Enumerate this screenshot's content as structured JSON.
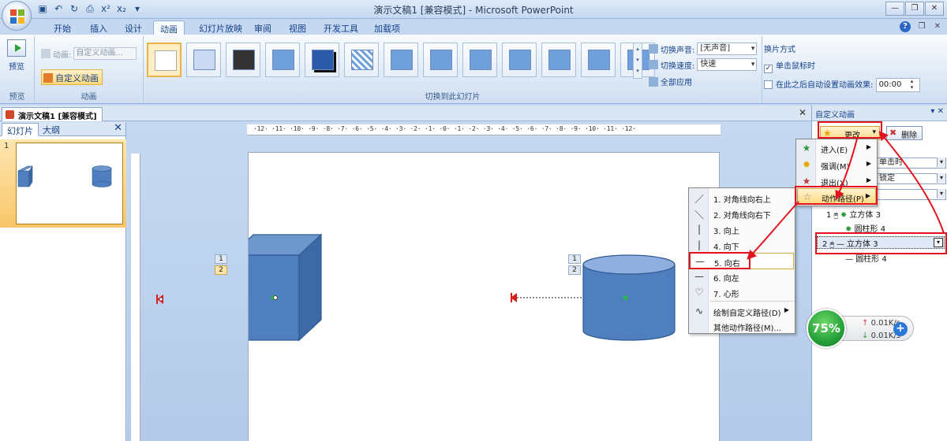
{
  "app": {
    "title": "演示文稿1 [兼容模式] - Microsoft PowerPoint",
    "doc_tab": "演示文稿1 [兼容模式]"
  },
  "ribbon_tabs": [
    "开始",
    "插入",
    "设计",
    "动画",
    "幻灯片放映",
    "审阅",
    "视图",
    "开发工具",
    "加载项"
  ],
  "active_tab": "动画",
  "ribbon": {
    "preview_label": "预览",
    "preview_group": "预览",
    "animate_label": "动画:",
    "animate_value": "自定义动画...",
    "custom_animation_btn": "自定义动画",
    "animation_group": "动画",
    "transition_group": "切换到此幻灯片",
    "sound_label": "切换声音:",
    "sound_value": "[无声音]",
    "speed_label": "切换速度:",
    "speed_value": "快速",
    "apply_all": "全部应用",
    "advance_title": "换片方式",
    "on_click": "单击鼠标时",
    "auto_after": "在此之后自动设置动画效果:",
    "auto_time": "00:00"
  },
  "left_pane": {
    "tab_slides": "幻灯片",
    "tab_outline": "大纲",
    "slide_number": "1"
  },
  "ruler_text": "·12· ·11· ·10· ·9· ·8· ·7· ·6· ·5· ·4· ·3· ·2· ·1· ·0· ·1· ·2· ·3· ·4· ·5· ·6· ·7· ·8· ·9· ·10· ·11· ·12·",
  "slide": {
    "cube_tags": [
      "1",
      "2"
    ],
    "cyl_tags": [
      "1",
      "2"
    ]
  },
  "task_pane": {
    "title": "自定义动画",
    "change_btn": "更改",
    "delete_btn": "删除",
    "start_value": "单击时",
    "dir_value": "锁定",
    "items": [
      {
        "num": "1",
        "name": "立方体 3"
      },
      {
        "num": "",
        "name": "圆柱形 4"
      },
      {
        "num": "2",
        "name": "立方体 3"
      },
      {
        "num": "",
        "name": "圆柱形 4"
      }
    ]
  },
  "change_menu": [
    {
      "label": "进入(E)"
    },
    {
      "label": "强调(M)"
    },
    {
      "label": "退出(X)"
    },
    {
      "label": "动作路径(P)"
    }
  ],
  "path_menu": [
    {
      "glyph": "／",
      "label": "1. 对角线向右上"
    },
    {
      "glyph": "＼",
      "label": "2. 对角线向右下"
    },
    {
      "glyph": "|",
      "label": "3. 向上"
    },
    {
      "glyph": "|",
      "label": "4. 向下"
    },
    {
      "glyph": "—",
      "label": "5. 向右"
    },
    {
      "glyph": "—",
      "label": "6. 向左"
    },
    {
      "glyph": "♡",
      "label": "7. 心形"
    },
    {
      "glyph": "∿",
      "label": "绘制自定义路径(D)"
    },
    {
      "glyph": "",
      "label": "其他动作路径(M)..."
    }
  ],
  "network": {
    "percent": "75%",
    "up": "0.01K/s",
    "down": "0.01K/s"
  },
  "colors": {
    "shape_fill": "#4f7fbf",
    "shape_stroke": "#2e5a92",
    "highlight_red": "#e2131c",
    "menu_hover": "#ffd980"
  }
}
